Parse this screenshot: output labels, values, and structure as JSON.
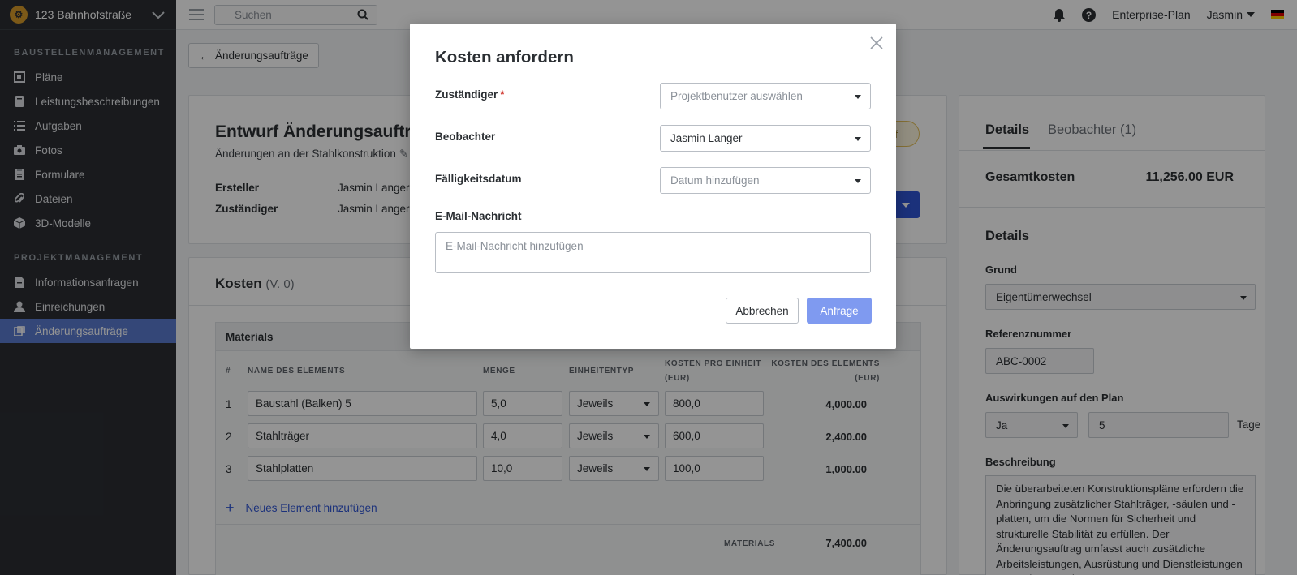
{
  "sidebar": {
    "project_name": "123 Bahnhofstraße",
    "sections": [
      {
        "title": "BAUSTELLENMANAGEMENT"
      },
      {
        "title": "PROJEKTMANAGEMENT"
      }
    ],
    "items": [
      {
        "label": "Pläne",
        "icon": "plans-icon"
      },
      {
        "label": "Leistungsbeschreibungen",
        "icon": "book-icon"
      },
      {
        "label": "Aufgaben",
        "icon": "list-icon"
      },
      {
        "label": "Fotos",
        "icon": "camera-icon"
      },
      {
        "label": "Formulare",
        "icon": "clipboard-icon"
      },
      {
        "label": "Dateien",
        "icon": "paperclip-icon"
      },
      {
        "label": "3D-Modelle",
        "icon": "cube-icon"
      },
      {
        "label": "Informationsanfragen",
        "icon": "document-icon"
      },
      {
        "label": "Einreichungen",
        "icon": "person-icon"
      },
      {
        "label": "Änderungsaufträge",
        "icon": "change-order-icon"
      }
    ],
    "active_item": "Änderungsaufträge"
  },
  "topbar": {
    "search_placeholder": "Suchen",
    "plan": "Enterprise-Plan",
    "user": "Jasmin"
  },
  "main": {
    "back_label": "Änderungsaufträge",
    "title": "Entwurf Änderungsauftrag",
    "subtitle": "Änderungen an der Stahlkonstruktion",
    "creator_label": "Ersteller",
    "creator_value": "Jasmin Langer (",
    "assignee_label": "Zuständiger",
    "assignee_value": "Jasmin Langer (",
    "status_fragment": "rf",
    "costs_title": "Kosten",
    "costs_version": "(V. 0)",
    "materials": {
      "title": "Materials",
      "headers": [
        "#",
        "NAME DES ELEMENTS",
        "MENGE",
        "EINHEITENTYP",
        "KOSTEN PRO EINHEIT",
        "(EUR)",
        "KOSTEN DES ELEMENTS",
        "(EUR)"
      ],
      "rows": [
        {
          "idx": "1",
          "name": "Baustahl (Balken) 5",
          "qty": "5,0",
          "unit": "Jeweils",
          "unit_cost": "800,0",
          "total": "4,000.00"
        },
        {
          "idx": "2",
          "name": "Stahlträger",
          "qty": "4,0",
          "unit": "Jeweils",
          "unit_cost": "600,0",
          "total": "2,400.00"
        },
        {
          "idx": "3",
          "name": "Stahlplatten",
          "qty": "10,0",
          "unit": "Jeweils",
          "unit_cost": "100,0",
          "total": "1,000.00"
        }
      ],
      "add_label": "Neues Element hinzufügen",
      "footer_label": "MATERIALS",
      "footer_total": "7,400.00"
    }
  },
  "details": {
    "tab_details": "Details",
    "tab_watchers": "Beobachter",
    "tab_watchers_count": "(1)",
    "total_label": "Gesamtkosten",
    "total_value": "11,256.00 EUR",
    "heading": "Details",
    "reason_label": "Grund",
    "reason_value": "Eigentümerwechsel",
    "ref_label": "Referenznummer",
    "ref_value": "ABC-0002",
    "impact_label": "Auswirkungen auf den Plan",
    "impact_value": "Ja",
    "impact_days": "5",
    "impact_unit": "Tage",
    "desc_label": "Beschreibung",
    "desc_value": "Die überarbeiteten Konstruktionspläne erfordern die Anbringung zusätzlicher Stahlträger, -säulen und -platten, um die Normen für Sicherheit und strukturelle Stabilität zu erfüllen. Der Änderungsauftrag umfasst auch zusätzliche Arbeitsleistungen, Ausrüstung und Dienstleistungen von Subunternehmern."
  },
  "modal": {
    "title": "Kosten anfordern",
    "assignee_label": "Zuständiger",
    "required_mark": "*",
    "assignee_placeholder": "Projektbenutzer auswählen",
    "watcher_label": "Beobachter",
    "watcher_value": "Jasmin Langer",
    "due_label": "Fälligkeitsdatum",
    "due_placeholder": "Datum hinzufügen",
    "email_label": "E-Mail-Nachricht",
    "email_placeholder": "E-Mail-Nachricht hinzufügen",
    "cancel_label": "Abbrechen",
    "submit_label": "Anfrage"
  },
  "colors": {
    "sidebar_bg": "#2b2e33",
    "active_item": "#5a7bcf",
    "primary": "#2f55d4",
    "submit_disabled": "#7f9af0",
    "required": "#d0342c"
  }
}
